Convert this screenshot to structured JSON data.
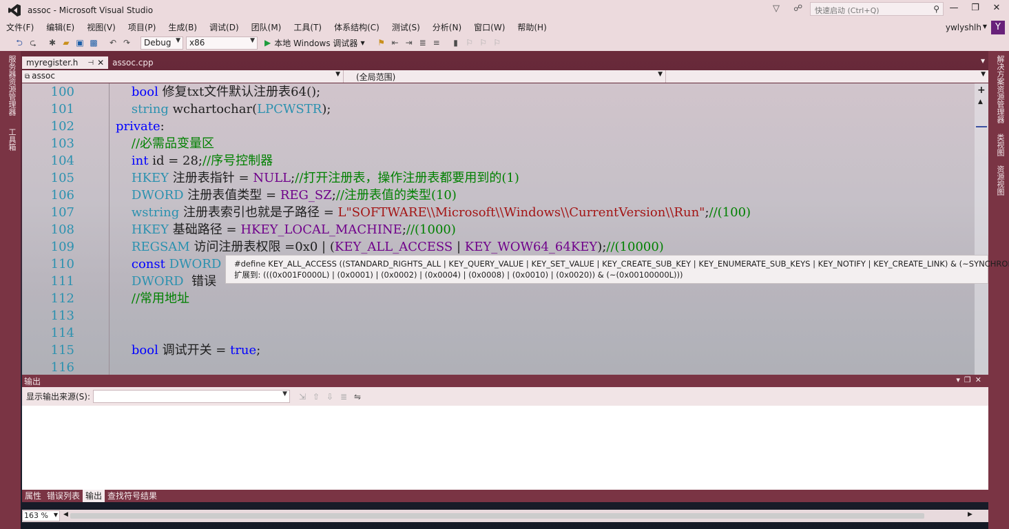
{
  "window": {
    "title": "assoc - Microsoft Visual Studio",
    "quick_launch": "快速启动 (Ctrl+Q)",
    "user": "ywlyshlh",
    "avatar": "Y"
  },
  "menu": [
    "文件(F)",
    "编辑(E)",
    "视图(V)",
    "项目(P)",
    "生成(B)",
    "调试(D)",
    "团队(M)",
    "工具(T)",
    "体系结构(C)",
    "测试(S)",
    "分析(N)",
    "窗口(W)",
    "帮助(H)"
  ],
  "toolbar": {
    "config": "Debug",
    "platform": "x86",
    "run": "本地 Windows 调试器"
  },
  "left_rail": [
    "服务器资源管理器",
    "工具箱"
  ],
  "right_rail": [
    "解决方案资源管理器",
    "类视图",
    "资源视图"
  ],
  "tabs": [
    {
      "label": "myregister.h",
      "active": true
    },
    {
      "label": "assoc.cpp",
      "active": false
    }
  ],
  "nav": {
    "project": "assoc",
    "scope": "(全局范围)",
    "member": ""
  },
  "code": {
    "line_numbers": [
      "100",
      "101",
      "102",
      "103",
      "104",
      "105",
      "106",
      "107",
      "108",
      "109",
      "110",
      "111",
      "112",
      "113",
      "114",
      "115",
      "116"
    ]
  },
  "tooltip": {
    "line1": "#define KEY_ALL_ACCESS ((STANDARD_RIGHTS_ALL | KEY_QUERY_VALUE | KEY_SET_VALUE | KEY_CREATE_SUB_KEY | KEY_ENUMERATE_SUB_KEYS | KEY_NOTIFY | KEY_CREATE_LINK) & (~SYNCHRONIZE))",
    "line2": "扩展到: (((0x001F0000L) | (0x0001) | (0x0002) | (0x0004) | (0x0008) | (0x0010) | (0x0020)) & (~(0x00100000L)))"
  },
  "output": {
    "title": "输出",
    "source_label": "显示输出来源(S):",
    "source_value": ""
  },
  "bottom_tabs": [
    {
      "label": "属性",
      "active": false
    },
    {
      "label": "错误列表",
      "active": false
    },
    {
      "label": "输出",
      "active": true
    },
    {
      "label": "查找符号结果",
      "active": false
    }
  ],
  "status": {
    "zoom": "163 %"
  }
}
